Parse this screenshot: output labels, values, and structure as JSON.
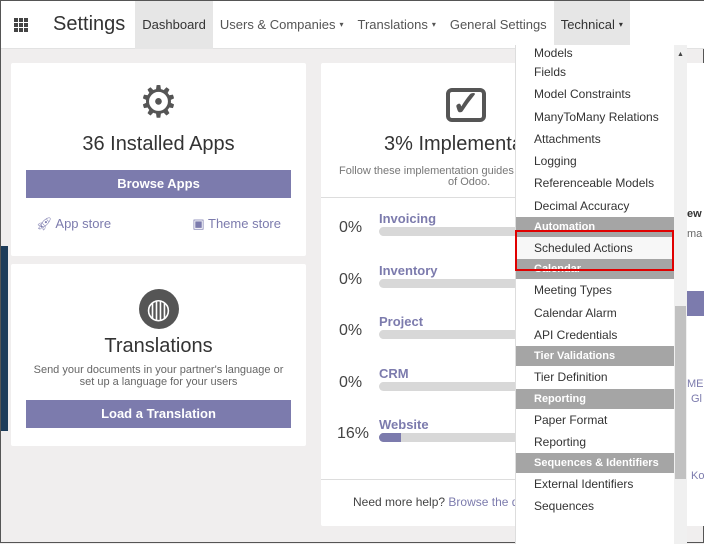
{
  "header": {
    "brand": "Settings",
    "menus": [
      {
        "label": "Dashboard"
      },
      {
        "label": "Users & Companies",
        "caret": "▾"
      },
      {
        "label": "Translations",
        "caret": "▾"
      },
      {
        "label": "General Settings"
      },
      {
        "label": "Technical",
        "caret": "▾"
      }
    ]
  },
  "apps_card": {
    "title": "36 Installed Apps",
    "button": "Browse Apps",
    "app_store": "App store",
    "theme_store": "Theme store"
  },
  "translations_card": {
    "title": "Translations",
    "description": "Send your documents in your partner's language or set up a language for your users",
    "button": "Load a Translation"
  },
  "implementation_card": {
    "title": "3% Implementa",
    "subtitle": "Follow these implementation guides t",
    "subtitle2": "of Odoo.",
    "rows": [
      {
        "pct": "0%",
        "label": "Invoicing",
        "progress": 0
      },
      {
        "pct": "0%",
        "label": "Inventory",
        "progress": 0
      },
      {
        "pct": "0%",
        "label": "Project",
        "progress": 0
      },
      {
        "pct": "0%",
        "label": "CRM",
        "progress": 0
      },
      {
        "pct": "16%",
        "label": "Website",
        "progress": 16
      }
    ],
    "help": "Need more help?",
    "help_link": "Browse the d"
  },
  "dropdown": {
    "items": [
      {
        "t": "item",
        "label": "Models"
      },
      {
        "t": "item",
        "label": "Fields"
      },
      {
        "t": "item",
        "label": "Model Constraints"
      },
      {
        "t": "item",
        "label": "ManyToMany Relations"
      },
      {
        "t": "item",
        "label": "Attachments"
      },
      {
        "t": "item",
        "label": "Logging"
      },
      {
        "t": "item",
        "label": "Referenceable Models"
      },
      {
        "t": "item",
        "label": "Decimal Accuracy"
      },
      {
        "t": "header",
        "label": "Automation"
      },
      {
        "t": "item",
        "label": "Scheduled Actions"
      },
      {
        "t": "header",
        "label": "Calendar"
      },
      {
        "t": "item",
        "label": "Meeting Types"
      },
      {
        "t": "item",
        "label": "Calendar Alarm"
      },
      {
        "t": "item",
        "label": "API Credentials"
      },
      {
        "t": "header",
        "label": "Tier Validations"
      },
      {
        "t": "item",
        "label": "Tier Definition"
      },
      {
        "t": "header",
        "label": "Reporting"
      },
      {
        "t": "item",
        "label": "Paper Format"
      },
      {
        "t": "item",
        "label": "Reporting"
      },
      {
        "t": "header",
        "label": "Sequences & Identifiers"
      },
      {
        "t": "item",
        "label": "External Identifiers"
      },
      {
        "t": "item",
        "label": "Sequences"
      }
    ]
  },
  "right_partial": [
    "ew",
    "ma",
    "ME",
    "Gl",
    "Ko"
  ],
  "colors": {
    "accent": "#7c7bad",
    "highlight": "#e00000"
  }
}
